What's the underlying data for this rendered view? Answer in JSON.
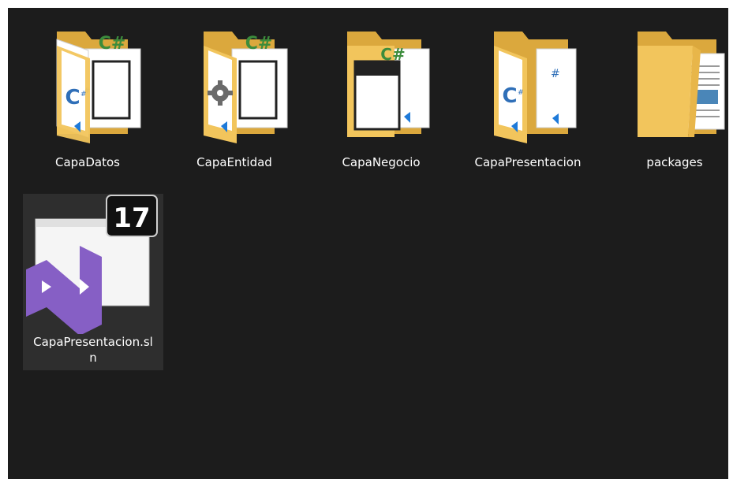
{
  "items": [
    {
      "name": "CapaDatos",
      "type": "folder",
      "overlay": "csharp-doc"
    },
    {
      "name": "CapaEntidad",
      "type": "folder",
      "overlay": "gear-doc"
    },
    {
      "name": "CapaNegocio",
      "type": "folder",
      "overlay": "window-doc"
    },
    {
      "name": "CapaPresentacion",
      "type": "folder",
      "overlay": "csharp-doc-vs"
    },
    {
      "name": "packages",
      "type": "folder",
      "overlay": "text-doc"
    },
    {
      "name": "CapaPresentacion.sln",
      "type": "solution",
      "badge": "17",
      "selected": true
    }
  ],
  "colors": {
    "folder": "#f2c55c",
    "folder_dark": "#dba83d",
    "csharp_green": "#3c8c3c",
    "vs_purple": "#865fc5",
    "vs_blue": "#1e7ad9",
    "selection": "#2e2e2e"
  }
}
